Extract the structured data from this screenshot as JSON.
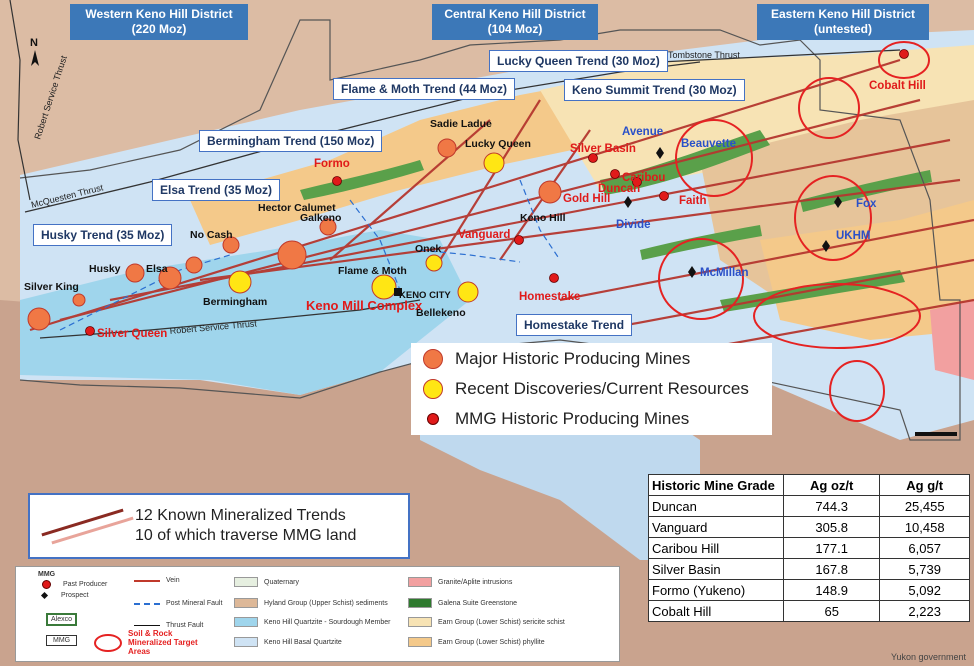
{
  "colors": {
    "water_blue": "#bfd9ee",
    "quartzite": "#cfe3f4",
    "sourdough": "#9fd5ec",
    "schist_sediment": "#ddb898",
    "phyllite": "#f4c98a",
    "sericite": "#f7e3b4",
    "greenstone": "#5aa04a",
    "granite": "#f2a0a0",
    "quaternary": "#d8e4d0",
    "trend_red": "#b5372f",
    "major_mine": "#f07845",
    "recent_mine": "#ffe614",
    "mmg_mine": "#e01a1a"
  },
  "districts": {
    "western": {
      "line1": "Western Keno Hill District",
      "line2": "(220 Moz)"
    },
    "central": {
      "line1": "Central Keno Hill District",
      "line2": "(104 Moz)"
    },
    "eastern": {
      "line1": "Eastern Keno Hill District",
      "line2": "(untested)"
    }
  },
  "trends": {
    "lucky_queen": "Lucky Queen Trend (30 Moz)",
    "flame_moth": "Flame & Moth Trend (44 Moz)",
    "keno_summit": "Keno Summit Trend (30 Moz)",
    "bermingham": "Bermingham Trend (150 Moz)",
    "elsa": "Elsa Trend (35 Moz)",
    "husky": "Husky Trend (35 Moz)",
    "homestake": "Homestake Trend"
  },
  "faults": {
    "tombstone": "Tombstone Thrust",
    "robert_service_vert": "Robert Service Thrust",
    "mcquesten": "McQuesten Thrust",
    "robert_service_low": "Robert Service Thrust"
  },
  "north": "N",
  "labels": {
    "cobalt_hill": "Cobalt Hill",
    "beauvette": "Beauvette",
    "avenue": "Avenue",
    "silver_basin": "Silver Basin",
    "caribou": "Caribou",
    "duncan": "Duncan",
    "faith": "Faith",
    "gold_hill": "Gold Hill",
    "divide": "Divide",
    "fox": "Fox",
    "ukhm": "UKHM",
    "mcmillan": "McMillan",
    "homestake": "Homestake",
    "sadie_ladue": "Sadie Ladue",
    "lucky_queen": "Lucky Queen",
    "keno_hill": "Keno Hill",
    "vanguard": "Vanguard",
    "onek": "Onek",
    "keno_city": "KENO CITY",
    "bellekeno": "Bellekeno",
    "flame_moth": "Flame & Moth",
    "keno_mill": "Keno Mill Complex",
    "formo": "Formo",
    "galkeno": "Galkeno",
    "hector_calumet": "Hector Calumet",
    "no_cash": "No Cash",
    "husky": "Husky",
    "elsa": "Elsa",
    "bermingham": "Bermingham",
    "silver_king": "Silver King",
    "silver_queen": "Silver Queen"
  },
  "legend_main": {
    "major": "Major Historic Producing Mines",
    "recent": "Recent Discoveries/Current Resources",
    "mmg": "MMG Historic Producing Mines"
  },
  "trend_legend": {
    "line1": "12 Known Mineralized Trends",
    "line2": "10 of which traverse MMG land"
  },
  "grade_table": {
    "headers": [
      "Historic Mine Grade",
      "Ag oz/t",
      "Ag g/t"
    ],
    "rows": [
      [
        "Duncan",
        "744.3",
        "25,455"
      ],
      [
        "Vanguard",
        "305.8",
        "10,458"
      ],
      [
        "Caribou Hill",
        "177.1",
        "6,057"
      ],
      [
        "Silver Basin",
        "167.8",
        "5,739"
      ],
      [
        "Formo (Yukeno)",
        "148.9",
        "5,092"
      ],
      [
        "Cobalt Hill",
        "65",
        "2,223"
      ]
    ]
  },
  "geo_legend": {
    "mmg": "MMG",
    "past_producer": "Past Producer",
    "prospect": "Prospect",
    "alexco": "Alexco",
    "mmg_box": "MMG",
    "vein": "Vein",
    "post_fault": "Post Mineral Fault",
    "thrust_fault": "Thrust Fault",
    "target_areas": "Soil & Rock Mineralized Target Areas",
    "quaternary": "Quaternary",
    "hyland": "Hyland Group (Upper Schist) sediments",
    "sourdough": "Keno Hill Quartzite - Sourdough Member",
    "basal": "Keno Hill Basal Quartzite",
    "granite": "Granite/Aplite intrusions",
    "greenstone": "Galena Suite Greenstone",
    "sericite": "Earn Group (Lower Schist) sericite schist",
    "phyllite": "Earn Group (Lower Schist) phyllite"
  },
  "credit": "Yukon government"
}
